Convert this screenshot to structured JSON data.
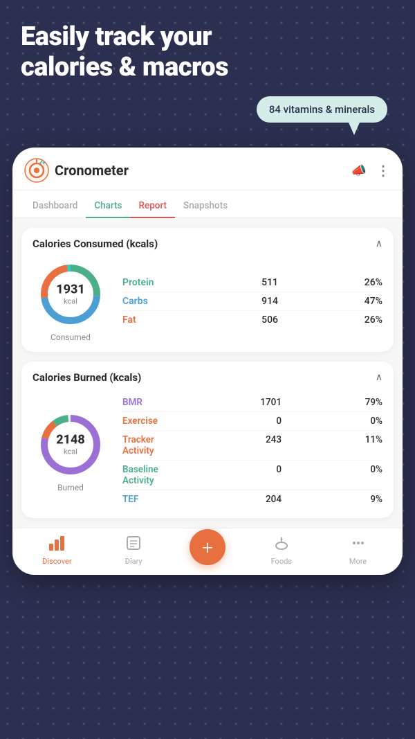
{
  "hero": {
    "line1": "Easily track your",
    "line2": "calories & macros"
  },
  "tooltip": {
    "text": "84 vitamins & minerals"
  },
  "app": {
    "name": "Cronometer",
    "tabs": [
      {
        "label": "Dashboard",
        "state": "inactive"
      },
      {
        "label": "Charts",
        "state": "active-green"
      },
      {
        "label": "Report",
        "state": "active-red"
      },
      {
        "label": "Snapshots",
        "state": "inactive"
      }
    ]
  },
  "consumed": {
    "title": "Calories Consumed (kcals)",
    "value": "1931",
    "unit": "kcal",
    "label": "Consumed",
    "macros": [
      {
        "name": "Protein",
        "class": "protein",
        "val": "511",
        "pct": "26%"
      },
      {
        "name": "Carbs",
        "class": "carbs",
        "val": "914",
        "pct": "47%"
      },
      {
        "name": "Fat",
        "class": "fat",
        "val": "506",
        "pct": "26%"
      }
    ]
  },
  "burned": {
    "title": "Calories Burned (kcals)",
    "value": "2148",
    "unit": "kcal",
    "label": "Burned",
    "items": [
      {
        "name": "BMR",
        "class": "bmr",
        "val": "1701",
        "pct": "79%"
      },
      {
        "name": "Exercise",
        "class": "exercise",
        "val": "0",
        "pct": "0%"
      },
      {
        "name": "Tracker Activity",
        "class": "tracker",
        "val": "243",
        "pct": "11%"
      },
      {
        "name": "Baseline Activity",
        "class": "baseline",
        "val": "0",
        "pct": "0%"
      },
      {
        "name": "TEF",
        "class": "tef",
        "val": "204",
        "pct": "9%"
      }
    ]
  },
  "bottomNav": {
    "items": [
      {
        "label": "Discover",
        "icon": "📊",
        "active": true
      },
      {
        "label": "Diary",
        "icon": "📋",
        "active": false
      },
      {
        "label": "+",
        "center": true
      },
      {
        "label": "Foods",
        "icon": "🍎",
        "active": false
      },
      {
        "label": "More",
        "icon": "···",
        "active": false
      }
    ]
  }
}
